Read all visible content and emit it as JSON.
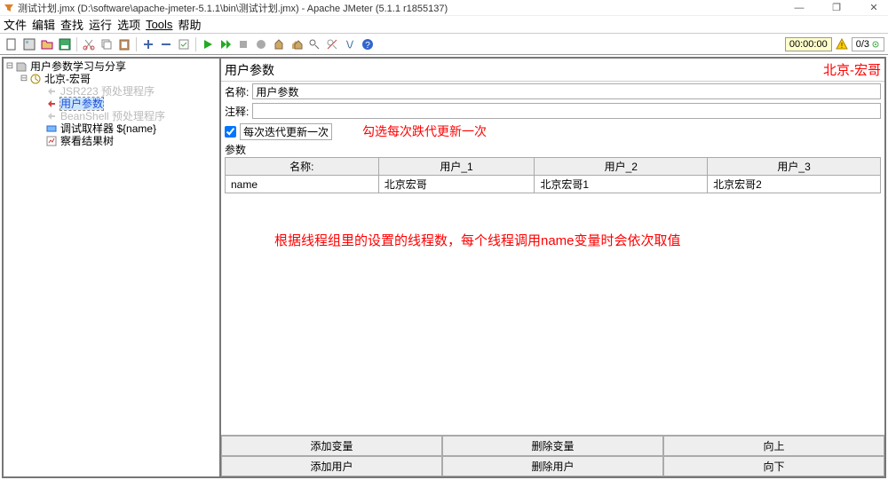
{
  "window": {
    "title": "测试计划.jmx (D:\\software\\apache-jmeter-5.1.1\\bin\\测试计划.jmx) - Apache JMeter (5.1.1 r1855137)"
  },
  "menu": [
    "文件",
    "编辑",
    "查找",
    "运行",
    "选项",
    "Tools",
    "帮助"
  ],
  "timer": "00:00:00",
  "threads": "0/3",
  "tree": {
    "n0": "用户参数学习与分享",
    "n1": "北京-宏哥",
    "n2": "JSR223 预处理程序",
    "n3": "用户参数",
    "n4": "BeanShell 预处理程序",
    "n5": "调试取样器 ${name}",
    "n6": "察看结果树"
  },
  "panel": {
    "title": "用户参数",
    "watermark": "北京-宏哥",
    "name_lbl": "名称:",
    "name_val": "用户参数",
    "note_lbl": "注释:",
    "note_val": "",
    "check_lbl": "每次迭代更新一次",
    "sub_lbl": "参数",
    "ann1": "勾选每次跌代更新一次",
    "ann2": "根据线程组里的设置的线程数，每个线程调用name变量时会依次取值"
  },
  "table": {
    "headers": [
      "名称:",
      "用户_1",
      "用户_2",
      "用户_3"
    ],
    "rows": [
      [
        "name",
        "北京宏哥",
        "北京宏哥1",
        "北京宏哥2"
      ]
    ]
  },
  "buttons": {
    "r1": [
      "添加变量",
      "删除变量",
      "向上"
    ],
    "r2": [
      "添加用户",
      "删除用户",
      "向下"
    ]
  }
}
